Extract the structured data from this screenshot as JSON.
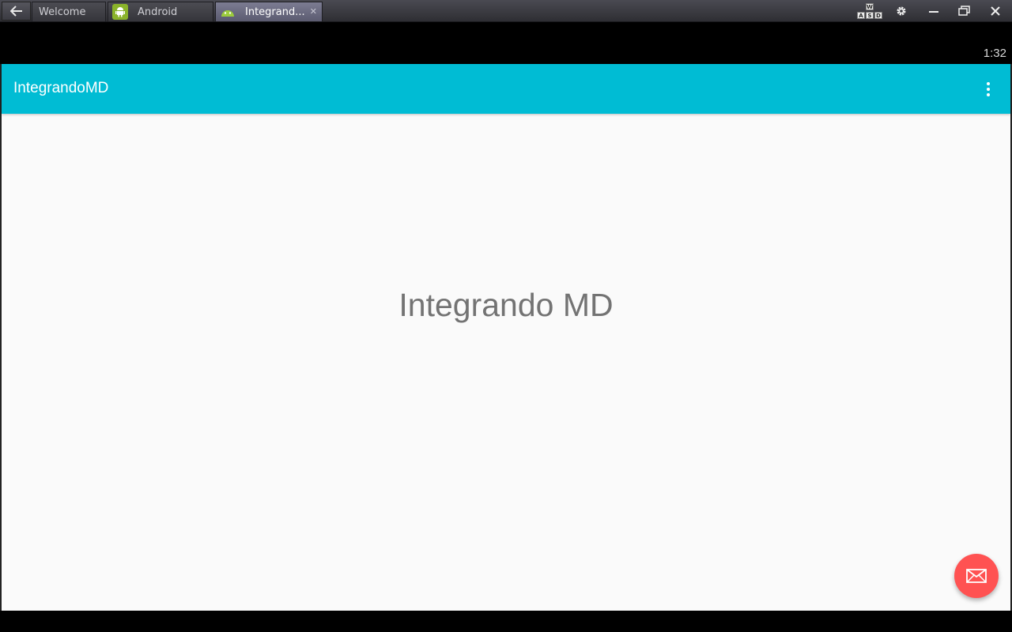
{
  "window": {
    "tabs": [
      {
        "label": "Welcome",
        "icon": "none"
      },
      {
        "label": "Android",
        "icon": "android-icon"
      },
      {
        "label": "Integrand...",
        "icon": "android-head-icon",
        "active": true
      }
    ],
    "controls": {
      "keymap_keys": [
        "W",
        "A",
        "S",
        "D"
      ]
    }
  },
  "status_bar": {
    "time": "1:32"
  },
  "app": {
    "toolbar_title": "IntegrandoMD",
    "toolbar_color": "#00bcd4",
    "center_text": "Integrando MD",
    "fab_color": "#ff5252",
    "fab_icon": "mail-icon"
  }
}
